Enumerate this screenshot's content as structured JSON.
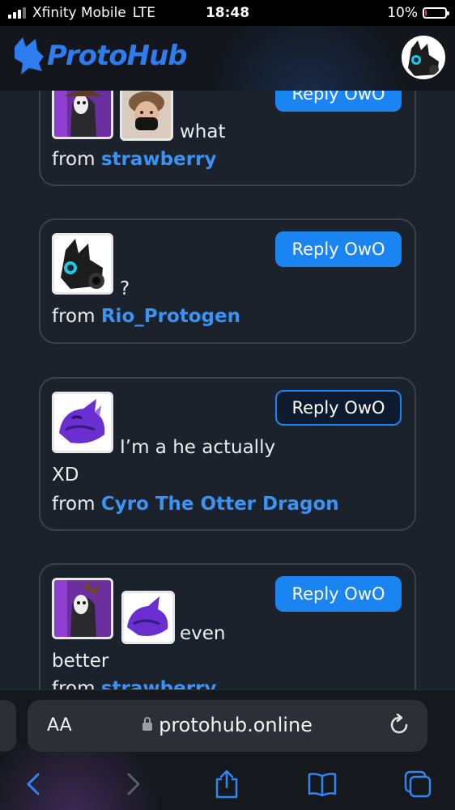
{
  "status_bar": {
    "carrier": "Xfinity Mobile",
    "network": "LTE",
    "time": "18:48",
    "battery": "10%",
    "battery_level": 0.1
  },
  "header": {
    "logo_text": "ProtoHub",
    "logo_icon": "protogen-head-logo",
    "profile_icon": "profile-avatar-protogen"
  },
  "posts": [
    {
      "reply_label": "Reply OwO",
      "lines": [
        "what"
      ],
      "from_prefix": "from",
      "from_name": "strawberry",
      "avatars": [
        "avatar-strawberry",
        "avatar-masked-person"
      ]
    },
    {
      "reply_label": "Reply OwO",
      "lines": [
        "?"
      ],
      "from_prefix": "from",
      "from_name": "Rio_Protogen",
      "avatars": [
        "avatar-rio-protogen"
      ]
    },
    {
      "reply_label": "Reply OwO",
      "lines": [
        "I’m a he actually",
        "XD"
      ],
      "from_prefix": "from",
      "from_name": "Cyro The Otter Dragon",
      "avatars": [
        "avatar-cyro-dragon"
      ]
    },
    {
      "reply_label": "Reply OwO",
      "lines": [
        "even",
        "better"
      ],
      "from_prefix": "from",
      "from_name": "strawberry",
      "avatars": [
        "avatar-strawberry",
        "avatar-cyro-dragon"
      ]
    }
  ],
  "browser": {
    "text_size_label": "AA",
    "url": "protohub.online",
    "icons": [
      "lock-icon",
      "reload-icon",
      "back-icon",
      "forward-icon",
      "share-icon",
      "bookmarks-icon",
      "tabs-icon"
    ]
  }
}
